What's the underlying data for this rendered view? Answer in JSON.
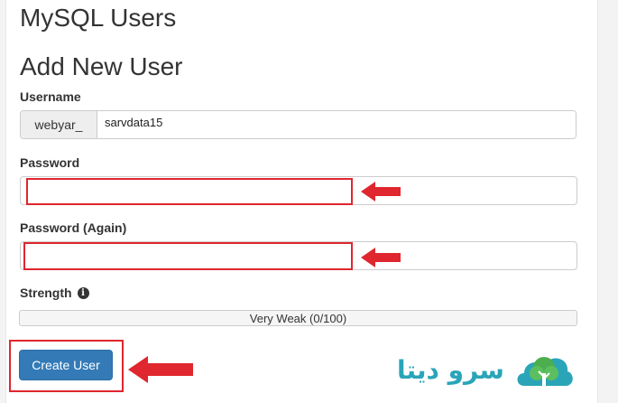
{
  "page": {
    "title": "MySQL Users",
    "subtitle": "Add New User"
  },
  "form": {
    "username_label": "Username",
    "username_prefix": "webyar_",
    "username_value": "sarvdata15",
    "password_label": "Password",
    "password_value": "",
    "password_again_label": "Password (Again)",
    "password_again_value": "",
    "strength_label": "Strength",
    "strength_icon": "info-icon",
    "strength_text": "Very Weak (0/100)",
    "strength_value": 0,
    "submit_label": "Create User"
  },
  "annotations": {
    "highlight_color": "#e0262e",
    "arrow_icon": "red-left-arrow-icon"
  },
  "branding": {
    "logo_text": "سرو دیتا",
    "logo_icon": "tree-cloud-icon",
    "logo_color": "#2aa5b8",
    "tree_color": "#4cae4f"
  },
  "colors": {
    "primary_button": "#337ab7",
    "border": "#cccccc",
    "prefix_bg": "#eeeeee"
  }
}
